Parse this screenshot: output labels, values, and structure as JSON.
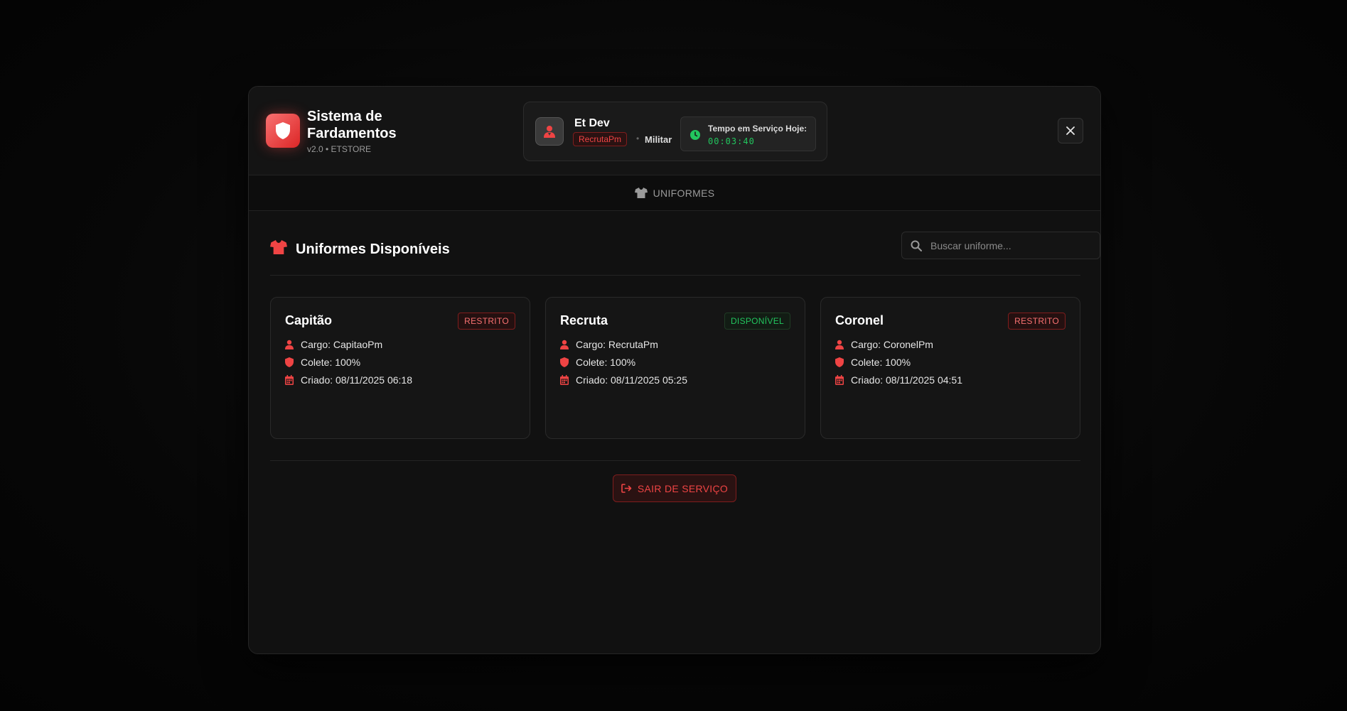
{
  "brand": {
    "title": "Sistema de Fardamentos",
    "subtitle": "v2.0 • ETSTORE"
  },
  "user": {
    "name": "Et Dev",
    "role": "RecrutaPm",
    "separator": "•",
    "type": "Militar",
    "timer_label": "Tempo em Serviço Hoje:",
    "timer_value": "00:03:40"
  },
  "tabs": [
    {
      "label": "UNIFORMES",
      "icon": "shirt-icon"
    }
  ],
  "section": {
    "title": "Uniformes Disponíveis",
    "search_placeholder": "Buscar uniforme..."
  },
  "uniforms": [
    {
      "name": "Capitão",
      "status": "RESTRITO",
      "cargo": "Cargo: CapitaoPm",
      "colete": "Colete: 100%",
      "criado": "Criado: 08/11/2025 06:18"
    },
    {
      "name": "Recruta",
      "status": "DISPONÍVEL",
      "cargo": "Cargo: RecrutaPm",
      "colete": "Colete: 100%",
      "criado": "Criado: 08/11/2025 05:25"
    },
    {
      "name": "Coronel",
      "status": "RESTRITO",
      "cargo": "Cargo: CoronelPm",
      "colete": "Colete: 100%",
      "criado": "Criado: 08/11/2025 04:51"
    }
  ],
  "actions": {
    "exit_label": "SAIR DE SERVIÇO"
  },
  "colors": {
    "accent": "#ef4444",
    "success": "#22c55e",
    "background": "#111111"
  }
}
